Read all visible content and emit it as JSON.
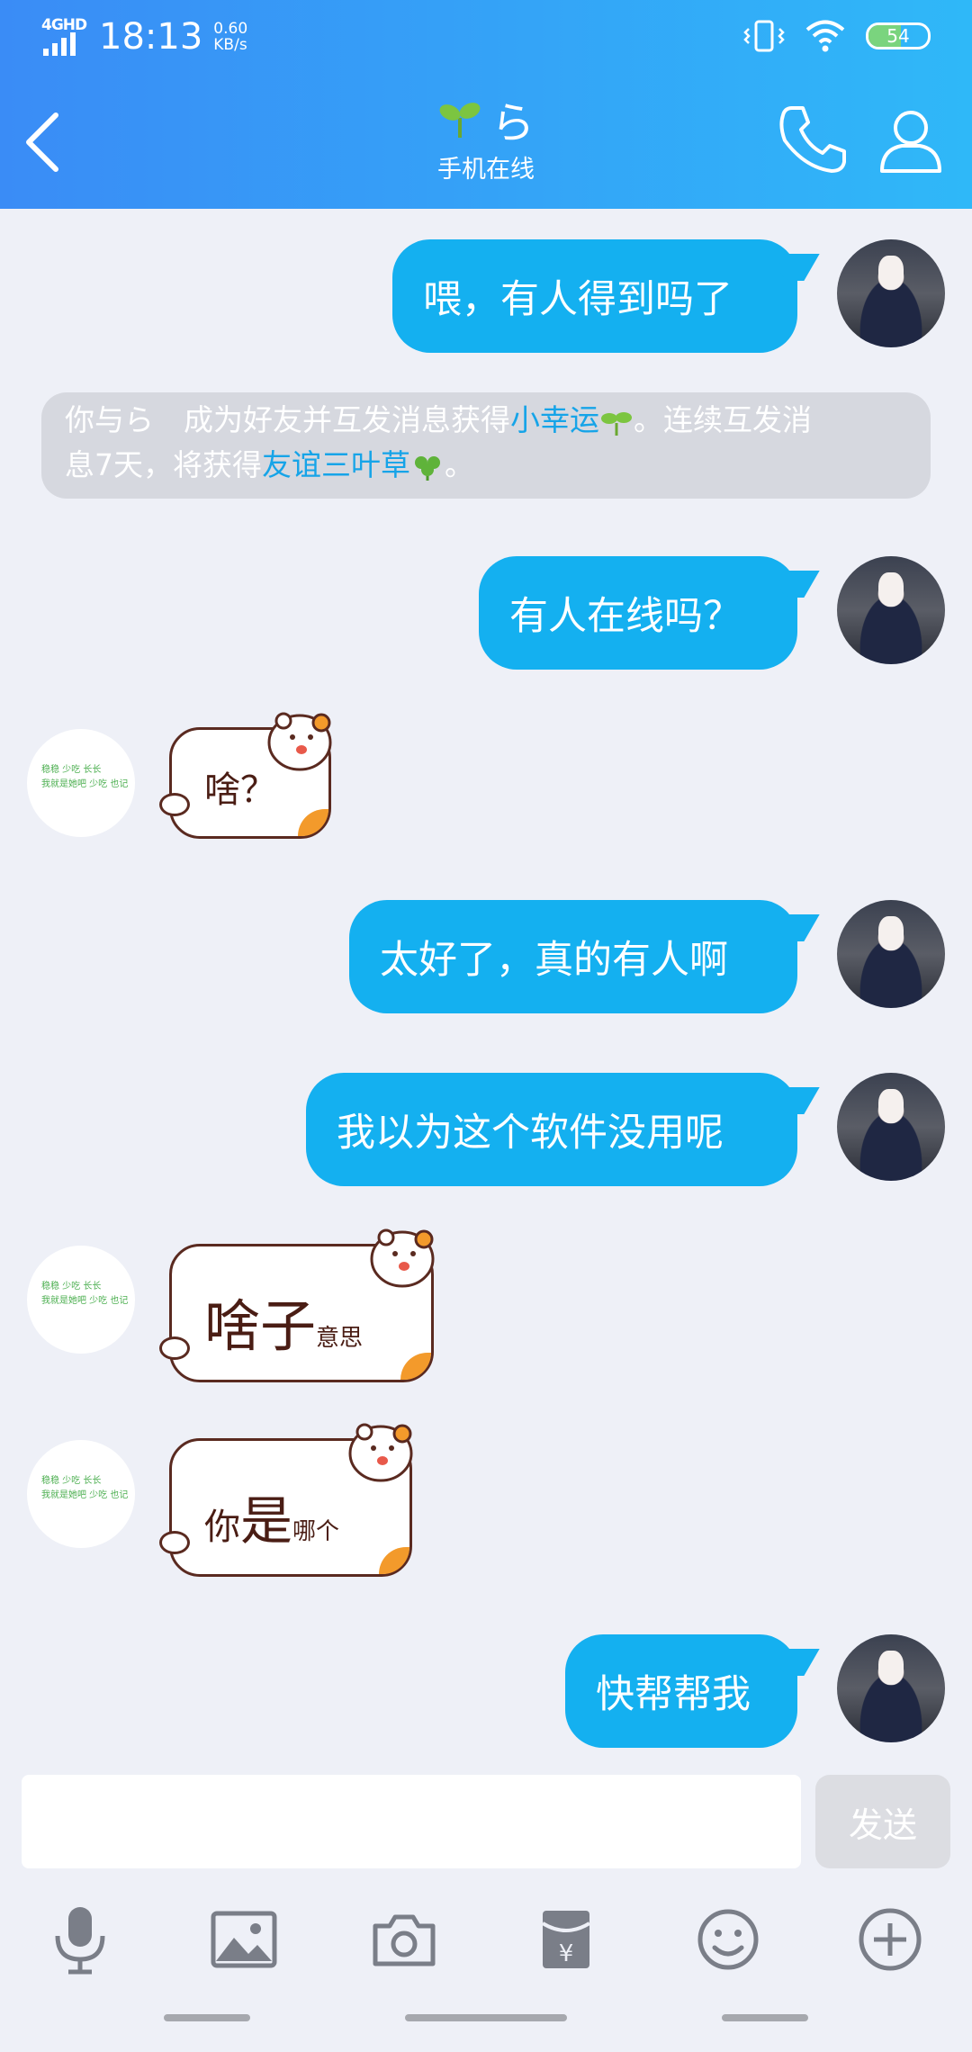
{
  "status_bar": {
    "network": "4GHD",
    "time": "18:13",
    "speed_value": "0.60",
    "speed_unit": "KB/s",
    "battery": "54",
    "battery_level_percent": 54,
    "icons": [
      "signal-icon",
      "vibrate-icon",
      "wifi-icon",
      "battery-icon"
    ]
  },
  "header": {
    "contact_name": "ら",
    "contact_status": "手机在线",
    "icons": [
      "back-icon",
      "sprout-icon",
      "phone-icon",
      "profile-icon"
    ]
  },
  "messages": [
    {
      "from": "self",
      "type": "text",
      "text": "喂，有人得到吗了"
    },
    {
      "from": "system",
      "type": "note",
      "text_1": "你与ら　成为好友并互发消息获得",
      "link_1": "小幸运",
      "text_2": "。连续互发消",
      "text_3": "息7天，将获得",
      "link_2": "友谊三叶草",
      "text_4": "。"
    },
    {
      "from": "self",
      "type": "text",
      "text": "有人在线吗？"
    },
    {
      "from": "other",
      "type": "sticker",
      "text": "啥？"
    },
    {
      "from": "self",
      "type": "text",
      "text": "太好了，真的有人啊"
    },
    {
      "from": "self",
      "type": "text",
      "text": "我以为这个软件没用呢"
    },
    {
      "from": "other",
      "type": "sticker",
      "text_big": "啥子",
      "text_small": "意思"
    },
    {
      "from": "other",
      "type": "sticker",
      "text_a": "你",
      "text_big": "是",
      "text_small": "哪个"
    },
    {
      "from": "self",
      "type": "text",
      "text": "快帮帮我"
    }
  ],
  "other_avatar_text_1": "稳稳 少吃 长长",
  "other_avatar_text_2": "我就是她吧 少吃 也记",
  "input": {
    "placeholder": "",
    "value": "",
    "send_label": "发送"
  },
  "toolbar": {
    "icons": [
      "microphone-icon",
      "image-icon",
      "camera-icon",
      "red-packet-icon",
      "emoji-icon",
      "plus-icon"
    ]
  },
  "colors": {
    "header_start": "#3a8cf6",
    "header_end": "#2fb8f8",
    "bubble": "#14b0f0",
    "link": "#16a4e8",
    "background": "#eef0f7"
  }
}
